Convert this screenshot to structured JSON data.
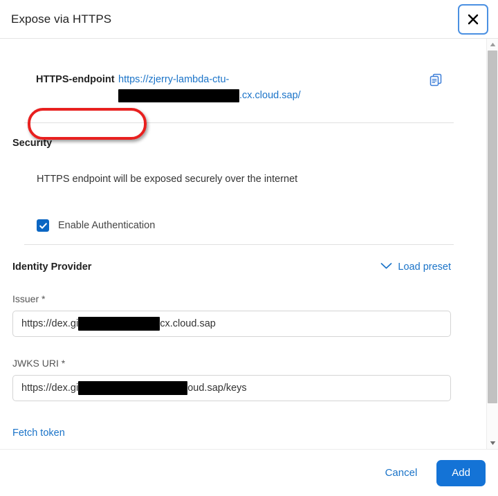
{
  "dialog": {
    "title": "Expose via HTTPS",
    "close_icon": "close-icon"
  },
  "endpoint": {
    "label": "HTTPS-endpoint",
    "url_line1": "https://zjerry-lambda-ctu-",
    "url_line2_suffix": ".cx.cloud.sap/",
    "copy_icon": "copy-icon"
  },
  "security": {
    "title": "Security",
    "description": "HTTPS endpoint will be exposed securely over the internet",
    "checkbox_label": "Enable Authentication",
    "checkbox_checked": true
  },
  "identity_provider": {
    "title": "Identity Provider",
    "load_preset_label": "Load preset",
    "load_preset_icon": "chevron-down-icon",
    "issuer": {
      "label": "Issuer *",
      "value_prefix": "https://dex.gi",
      "value_suffix": "cx.cloud.sap"
    },
    "jwks": {
      "label": "JWKS URI *",
      "value_prefix": "https://dex.gi",
      "value_suffix": "oud.sap/keys"
    },
    "fetch_token_label": "Fetch token"
  },
  "footer": {
    "cancel_label": "Cancel",
    "add_label": "Add"
  },
  "scrollbar": {
    "up_icon": "scroll-up-arrow-icon",
    "down_icon": "scroll-down-arrow-icon"
  },
  "colors": {
    "link": "#1a73c8",
    "primary_button": "#1473d6",
    "checkbox": "#0b66c3",
    "annotation": "#e8201f"
  }
}
